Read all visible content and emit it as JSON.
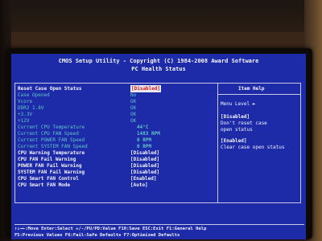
{
  "header": {
    "title": "CMOS Setup Utility - Copyright (C) 1984-2008 Award Software",
    "subtitle": "PC Health Status"
  },
  "settings": [
    {
      "label": "Reset Case Open Status",
      "value": "[Disabled]"
    },
    {
      "label": "Case Opened",
      "value": "No"
    },
    {
      "label": "Vcore",
      "value": "OK"
    },
    {
      "label": "DDR2 1.8V",
      "value": "OK"
    },
    {
      "label": "+3.3V",
      "value": "OK"
    },
    {
      "label": "+12V",
      "value": "OK"
    },
    {
      "label": "Current CPU Temperature",
      "value": "44°C"
    },
    {
      "label": "Current CPU FAN Speed",
      "value": "1483 RPM"
    },
    {
      "label": "Current POWER FAN Speed",
      "value": "0 RPM"
    },
    {
      "label": "Current SYSTEM FAN Speed",
      "value": "0 RPM"
    },
    {
      "label": "CPU Warning Temperature",
      "value": "[Disabled]"
    },
    {
      "label": "CPU FAN Fail Warning",
      "value": "[Disabled]"
    },
    {
      "label": "POWER FAN Fail Warning",
      "value": "[Disabled]"
    },
    {
      "label": "SYSTEM FAN Fail Warning",
      "value": "[Disabled]"
    },
    {
      "label": "CPU Smart FAN Control",
      "value": "[Enabled]"
    },
    {
      "label": "CPU Smart FAN Mode",
      "value": "[Auto]"
    }
  ],
  "item_help": {
    "title": "Item Help",
    "menu_level": "Menu Level   ►",
    "opt1_title": "[Disabled]",
    "opt1_line1": "Don't reset case",
    "opt1_line2": "open status",
    "opt2_title": "[Enabled]",
    "opt2_line1": "Clear case open status"
  },
  "footer": {
    "line1": "↑↓→←:Move  Enter:Select  +/-/PU/PD:Value  F10:Save  ESC:Exit  F1:General Help",
    "line2": "F5:Previous Values  F6:Fail-Safe Defaults  F7:Optimized Defaults"
  }
}
